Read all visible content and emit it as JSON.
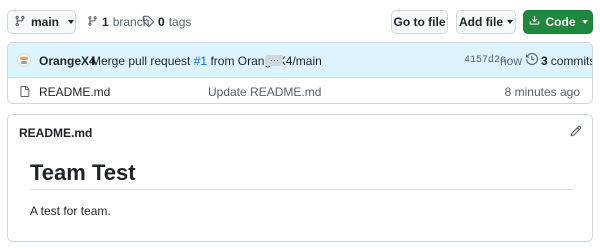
{
  "toolbar": {
    "branch_label": "main",
    "branches": {
      "count": "1",
      "label": "branch"
    },
    "tags": {
      "count": "0",
      "label": "tags"
    },
    "go_to_file_label": "Go to file",
    "add_file_label": "Add file",
    "code_label": "Code"
  },
  "commit": {
    "author": "OrangeX4",
    "message_prefix": "Merge pull request",
    "pr_ref": "#1",
    "message_suffix": "from OrangeX4/main",
    "ellipsis": "…",
    "sha": "4157d2c",
    "time": "now",
    "commits_count": "3",
    "commits_label": "commits"
  },
  "files": [
    {
      "name": "README.md",
      "message": "Update README.md",
      "time": "8 minutes ago"
    }
  ],
  "readme": {
    "header": "README.md",
    "title": "Team Test",
    "body": "A test for team."
  },
  "colors": {
    "accent_green": "#1f883d",
    "link_blue": "#0969da",
    "commit_bar": "#ddf4ff"
  },
  "icons": [
    "git-branch-icon",
    "tag-icon",
    "download-icon",
    "history-icon",
    "file-icon",
    "pencil-icon"
  ]
}
